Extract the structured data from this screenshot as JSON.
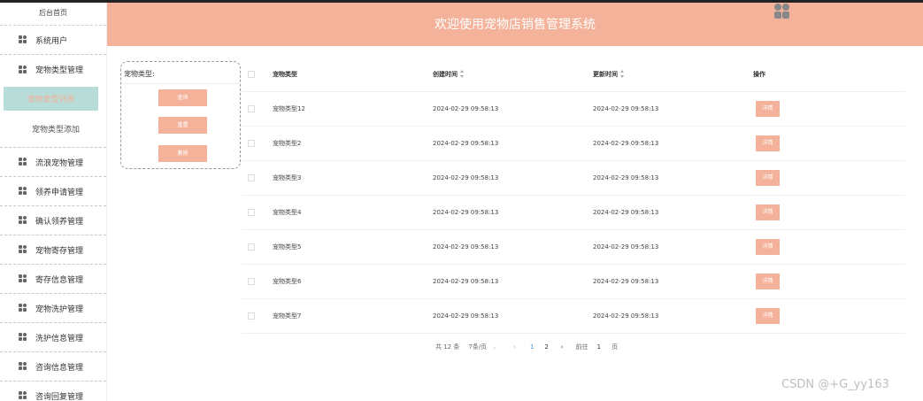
{
  "sidebar": {
    "title": "后台首页",
    "items_before": [
      {
        "label": "系统用户"
      },
      {
        "label": "宠物类型管理"
      }
    ],
    "sub_active": "宠物类型列表",
    "sub_add": "宠物类型添加",
    "items_after": [
      {
        "label": "流浪宠物管理"
      },
      {
        "label": "领养申请管理"
      },
      {
        "label": "确认领养管理"
      },
      {
        "label": "宠物寄存管理"
      },
      {
        "label": "寄存信息管理"
      },
      {
        "label": "宠物洗护管理"
      },
      {
        "label": "洗护信息管理"
      },
      {
        "label": "咨询信息管理"
      },
      {
        "label": "咨询回复管理"
      }
    ]
  },
  "header": {
    "title": "欢迎使用宠物店销售管理系统"
  },
  "search": {
    "label": "宠物类型:",
    "query_button": "查询",
    "reset_button": "重置",
    "delete_button": "删除"
  },
  "table": {
    "headers": {
      "type": "宠物类型",
      "created": "创建时间",
      "updated": "更新时间",
      "operation": "操作"
    },
    "rows": [
      {
        "type": "宠物类型12",
        "created": "2024-02-29 09:58:13",
        "updated": "2024-02-29 09:58:13",
        "action": "详情"
      },
      {
        "type": "宠物类型2",
        "created": "2024-02-29 09:58:13",
        "updated": "2024-02-29 09:58:13",
        "action": "详情"
      },
      {
        "type": "宠物类型3",
        "created": "2024-02-29 09:58:13",
        "updated": "2024-02-29 09:58:13",
        "action": "详情"
      },
      {
        "type": "宠物类型4",
        "created": "2024-02-29 09:58:13",
        "updated": "2024-02-29 09:58:13",
        "action": "详情"
      },
      {
        "type": "宠物类型5",
        "created": "2024-02-29 09:58:13",
        "updated": "2024-02-29 09:58:13",
        "action": "详情"
      },
      {
        "type": "宠物类型6",
        "created": "2024-02-29 09:58:13",
        "updated": "2024-02-29 09:58:13",
        "action": "详情"
      },
      {
        "type": "宠物类型7",
        "created": "2024-02-29 09:58:13",
        "updated": "2024-02-29 09:58:13",
        "action": "详情"
      }
    ]
  },
  "pagination": {
    "total": "共 12 条",
    "page_size": "7条/页",
    "pages": [
      "1",
      "2"
    ],
    "current_page": "1",
    "goto_label": "前往",
    "goto_value": "1",
    "page_unit": "页"
  },
  "watermark": "CSDN @+G_yy163",
  "colors": {
    "accent": "#f4b29a",
    "active_menu_bg": "#b8dcd8",
    "active_page": "#3a8ee6"
  }
}
